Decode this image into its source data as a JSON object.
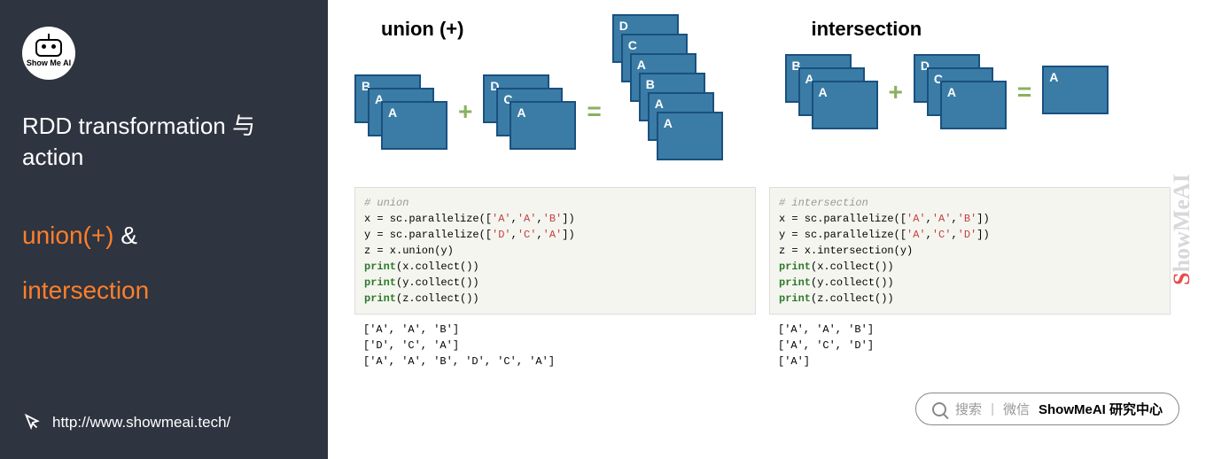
{
  "sidebar": {
    "logo_text": "Show Me AI",
    "title": "RDD transformation 与action",
    "op1": "union(+)",
    "amp": "&",
    "op2": "intersection",
    "url": "http://www.showmeai.tech/"
  },
  "diagrams": {
    "union": {
      "title": "union (+)",
      "stack_a": [
        "B",
        "A",
        "A"
      ],
      "stack_b": [
        "D",
        "C",
        "A"
      ],
      "result": [
        "D",
        "C",
        "A",
        "B",
        "A",
        "A"
      ],
      "op1": "+",
      "op2": "="
    },
    "intersection": {
      "title": "intersection",
      "stack_a": [
        "B",
        "A",
        "A"
      ],
      "stack_b": [
        "D",
        "C",
        "A"
      ],
      "result": [
        "A"
      ],
      "op1": "+",
      "op2": "="
    }
  },
  "code": {
    "union": {
      "comment": "# union",
      "l1a": "x = sc.parallelize([",
      "l1b": "'A'",
      "l1c": ",",
      "l1d": "'A'",
      "l1e": ",",
      "l1f": "'B'",
      "l1g": "])",
      "l2a": "y = sc.parallelize([",
      "l2b": "'D'",
      "l2c": ",",
      "l2d": "'C'",
      "l2e": ",",
      "l2f": "'A'",
      "l2g": "])",
      "l3": "z = x.union(y)",
      "p1a": "print",
      "p1b": "(x.collect())",
      "p2a": "print",
      "p2b": "(y.collect())",
      "p3a": "print",
      "p3b": "(z.collect())",
      "out1": "['A', 'A', 'B']",
      "out2": "['D', 'C', 'A']",
      "out3": "['A', 'A', 'B', 'D', 'C', 'A']"
    },
    "intersection": {
      "comment": "# intersection",
      "l1a": "x = sc.parallelize([",
      "l1b": "'A'",
      "l1c": ",",
      "l1d": "'A'",
      "l1e": ",",
      "l1f": "'B'",
      "l1g": "])",
      "l2a": "y = sc.parallelize([",
      "l2b": "'A'",
      "l2c": ",",
      "l2d": "'C'",
      "l2e": ",",
      "l2f": "'D'",
      "l2g": "])",
      "l3": "z = x.intersection(y)",
      "p1a": "print",
      "p1b": "(x.collect())",
      "p2a": "print",
      "p2b": "(y.collect())",
      "p3a": "print",
      "p3b": "(z.collect())",
      "out1": "['A', 'A', 'B']",
      "out2": "['A', 'C', 'D']",
      "out3": "['A']"
    }
  },
  "brand": {
    "s": "S",
    "rest": "howMeAI"
  },
  "search": {
    "t1": "搜索",
    "t2": "微信",
    "t3": "ShowMeAI 研究中心"
  }
}
